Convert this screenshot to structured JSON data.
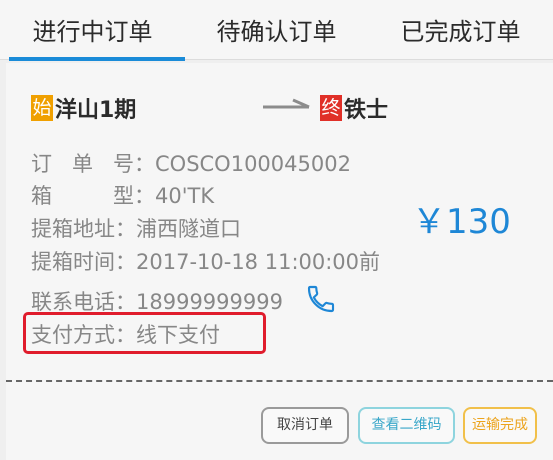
{
  "tabs": [
    {
      "label": "进行中订单"
    },
    {
      "label": "待确认订单"
    },
    {
      "label": "已完成订单"
    }
  ],
  "route": {
    "start_tag": "始",
    "from": "洋山1期",
    "end_tag": "终",
    "to": "铁士"
  },
  "order": {
    "number_label_chars": [
      "订",
      "单",
      "号"
    ],
    "number": "COSCO100045002",
    "box_type_label_chars": [
      "箱",
      "型"
    ],
    "box_type": "40'TK",
    "pickup_address_label": "提箱地址",
    "pickup_address": "浦西隧道口",
    "pickup_time_label": "提箱时间",
    "pickup_time": "2017-10-18 11:00:00前",
    "phone_label": "联系电话",
    "phone": "18999999999",
    "payment_label": "支付方式",
    "payment": "线下支付",
    "colon": "：",
    "price": "￥130"
  },
  "actions": {
    "cancel_label": "取消订单",
    "qr_label": "查看二维码",
    "complete_label": "运输完成"
  },
  "colors": {
    "accent_blue": "#1a8bd8",
    "start_tag": "#f0a000",
    "end_tag": "#e03028",
    "highlight": "#e01c2c"
  },
  "icons": {
    "phone": "phone-icon",
    "route_arrow": "arrow-right-icon"
  }
}
